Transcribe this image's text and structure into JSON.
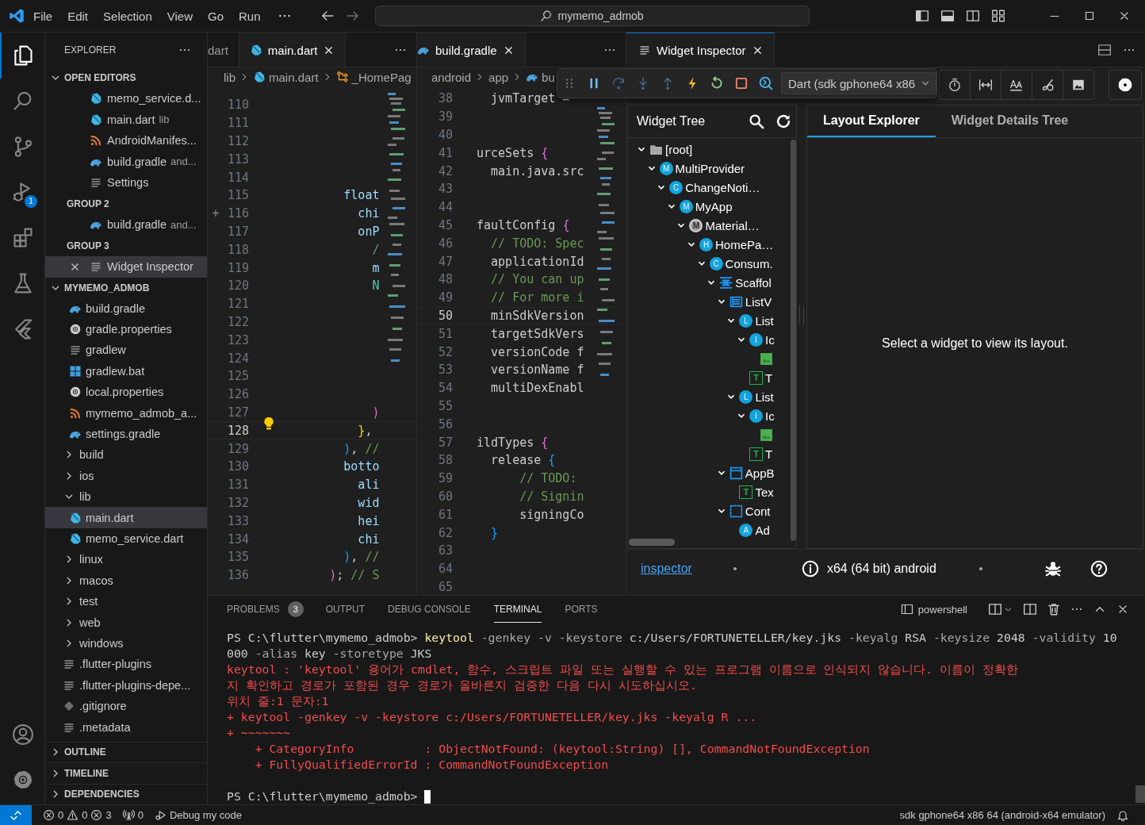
{
  "title_bar": {
    "menus": [
      "File",
      "Edit",
      "Selection",
      "View",
      "Go",
      "Run"
    ],
    "search": "mymemo_admob"
  },
  "activity_bar": {
    "items": [
      {
        "kind": "explorer",
        "selected": true
      },
      {
        "kind": "search",
        "selected": false
      },
      {
        "kind": "source-control",
        "selected": false
      },
      {
        "kind": "run-debug",
        "selected": false,
        "badge": "1"
      },
      {
        "kind": "extensions",
        "selected": false
      },
      {
        "kind": "testing",
        "selected": false
      },
      {
        "kind": "flutter",
        "selected": false
      }
    ],
    "bottom": [
      {
        "kind": "account"
      },
      {
        "kind": "manage"
      }
    ]
  },
  "sidebar": {
    "title": "EXPLORER",
    "open_editors": {
      "title": "OPEN EDITORS",
      "expanded": true,
      "groups": [
        {
          "items": [
            {
              "label": "memo_service.d...",
              "kind": "dart",
              "selected": false
            },
            {
              "label": "main.dart",
              "kind": "dart",
              "description": "lib",
              "selected": false
            },
            {
              "label": "AndroidManifes...",
              "kind": "xml",
              "selected": false
            },
            {
              "label": "build.gradle",
              "kind": "gradle",
              "description": "and...",
              "selected": false
            },
            {
              "label": "Settings",
              "kind": "lines",
              "selected": false
            }
          ]
        },
        {
          "title": "GROUP 2",
          "items": [
            {
              "label": "build.gradle",
              "kind": "gradle",
              "description": "and...",
              "selected": false
            }
          ]
        },
        {
          "title": "GROUP 3",
          "items": [
            {
              "label": "Widget Inspector",
              "kind": "lines",
              "selected": true
            }
          ]
        }
      ]
    },
    "project": {
      "title": "MYMEMO_ADMOB",
      "expanded": true,
      "items": [
        {
          "children": [
            {
              "label": "build.gradle",
              "kind": "gradle",
              "selected": false
            },
            {
              "label": "gradle.properties",
              "kind": "gear",
              "selected": false
            },
            {
              "label": "gradlew",
              "kind": "lines",
              "selected": false
            },
            {
              "label": "gradlew.bat",
              "kind": "windows",
              "selected": false
            },
            {
              "label": "local.properties",
              "kind": "gear",
              "selected": false
            },
            {
              "label": "mymemo_admob_a...",
              "kind": "xml",
              "selected": false
            },
            {
              "label": "settings.gradle",
              "kind": "gradle",
              "selected": false
            }
          ]
        },
        {
          "label": "build",
          "kind": "folder",
          "expanded": false
        },
        {
          "label": "ios",
          "kind": "folder",
          "expanded": false
        },
        {
          "label": "lib",
          "kind": "folder",
          "expanded": true,
          "children": [
            {
              "label": "main.dart",
              "kind": "dart",
              "selected": true
            },
            {
              "label": "memo_service.dart",
              "kind": "dart",
              "selected": false
            }
          ]
        },
        {
          "label": "linux",
          "kind": "folder",
          "expanded": false
        },
        {
          "label": "macos",
          "kind": "folder",
          "expanded": false
        },
        {
          "label": "test",
          "kind": "folder",
          "expanded": false
        },
        {
          "label": "web",
          "kind": "folder",
          "expanded": false
        },
        {
          "label": "windows",
          "kind": "folder",
          "expanded": false
        },
        {
          "label": ".flutter-plugins",
          "kind": "lines",
          "selected": false
        },
        {
          "label": ".flutter-plugins-depe...",
          "kind": "lines",
          "selected": false
        },
        {
          "label": ".gitignore",
          "kind": "git",
          "selected": false
        },
        {
          "label": ".metadata",
          "kind": "lines",
          "selected": false
        }
      ]
    },
    "sections": [
      {
        "title": "OUTLINE",
        "expanded": false
      },
      {
        "title": "TIMELINE",
        "expanded": false
      },
      {
        "title": "DEPENDENCIES",
        "expanded": false
      }
    ]
  },
  "editor_groups": [
    {
      "active": false,
      "tabs": [
        {
          "label": "dart",
          "kind": "plain",
          "selected": false
        },
        {
          "label": "main.dart",
          "kind": "dart",
          "selected": true
        }
      ],
      "breadcrumbs": [
        {
          "label": "lib",
          "kind": "plain"
        },
        {
          "label": "main.dart",
          "kind": "dart"
        },
        {
          "label": "_HomePag",
          "kind": "class"
        }
      ],
      "lines": [
        {
          "number": "110",
          "current": false
        },
        {
          "number": "111",
          "current": false
        },
        {
          "number": "112",
          "current": false
        },
        {
          "number": "113",
          "current": false
        },
        {
          "number": "114",
          "current": false
        },
        {
          "number": "115",
          "current": false,
          "parts": [
            {
              "text": "          float",
              "kind": "property"
            }
          ]
        },
        {
          "number": "116",
          "current": false,
          "gutter": "+",
          "parts": [
            {
              "text": "            chi",
              "kind": "property"
            }
          ]
        },
        {
          "number": "117",
          "current": false,
          "parts": [
            {
              "text": "            onP",
              "kind": "property"
            }
          ]
        },
        {
          "number": "118",
          "current": false,
          "parts": [
            {
              "text": "              /",
              "kind": "comment"
            }
          ]
        },
        {
          "number": "119",
          "current": false,
          "parts": [
            {
              "text": "              m",
              "kind": "property"
            }
          ]
        },
        {
          "number": "120",
          "current": false,
          "parts": [
            {
              "text": "              N",
              "kind": "type"
            }
          ]
        },
        {
          "number": "121",
          "current": false
        },
        {
          "number": "122",
          "current": false
        },
        {
          "number": "123",
          "current": false
        },
        {
          "number": "124",
          "current": false
        },
        {
          "number": "125",
          "current": false
        },
        {
          "number": "126",
          "current": false
        },
        {
          "number": "127",
          "current": false,
          "parts": [
            {
              "text": "              )",
              "kind": "bracket-pink"
            }
          ]
        },
        {
          "number": "128",
          "current": true,
          "lightbulb": true,
          "parts": [
            {
              "text": "            }",
              "kind": "bracket-yellow"
            },
            {
              "text": ",",
              "kind": "plain"
            }
          ]
        },
        {
          "number": "129",
          "current": false,
          "parts": [
            {
              "text": "          )",
              "kind": "bracket-blue"
            },
            {
              "text": ", ",
              "kind": "plain"
            },
            {
              "text": "//",
              "kind": "comment"
            }
          ]
        },
        {
          "number": "130",
          "current": false,
          "parts": [
            {
              "text": "          botto",
              "kind": "property"
            }
          ]
        },
        {
          "number": "131",
          "current": false,
          "parts": [
            {
              "text": "            ali",
              "kind": "property"
            }
          ]
        },
        {
          "number": "132",
          "current": false,
          "parts": [
            {
              "text": "            wid",
              "kind": "property"
            }
          ]
        },
        {
          "number": "133",
          "current": false,
          "parts": [
            {
              "text": "            hei",
              "kind": "property"
            }
          ]
        },
        {
          "number": "134",
          "current": false,
          "parts": [
            {
              "text": "            chi",
              "kind": "property"
            }
          ]
        },
        {
          "number": "135",
          "current": false,
          "parts": [
            {
              "text": "          )",
              "kind": "bracket-blue"
            },
            {
              "text": ", ",
              "kind": "plain"
            },
            {
              "text": "//",
              "kind": "comment"
            }
          ]
        },
        {
          "number": "136",
          "current": false,
          "parts": [
            {
              "text": "        )",
              "kind": "bracket-pink"
            },
            {
              "text": "; ",
              "kind": "plain"
            },
            {
              "text": "// S",
              "kind": "comment"
            }
          ]
        }
      ]
    },
    {
      "active": false,
      "tabs": [
        {
          "label": "build.gradle",
          "kind": "gradle",
          "selected": true
        }
      ],
      "breadcrumbs": [
        {
          "label": "android",
          "kind": "plain"
        },
        {
          "label": "app",
          "kind": "plain"
        },
        {
          "label": "bu",
          "kind": "gradle"
        }
      ],
      "lines": [
        {
          "number": "38",
          "current": false,
          "parts": [
            {
              "text": "  jvmTarget =",
              "kind": "plain"
            }
          ]
        },
        {
          "number": "39",
          "current": false
        },
        {
          "number": "40",
          "current": false
        },
        {
          "number": "41",
          "current": false,
          "parts": [
            {
              "text": "urceSets ",
              "kind": "plain"
            },
            {
              "text": "{",
              "kind": "bracket-pink"
            }
          ]
        },
        {
          "number": "42",
          "current": false,
          "parts": [
            {
              "text": "  main.java.src",
              "kind": "plain"
            }
          ]
        },
        {
          "number": "43",
          "current": false
        },
        {
          "number": "44",
          "current": false
        },
        {
          "number": "45",
          "current": false,
          "parts": [
            {
              "text": "faultConfig ",
              "kind": "plain"
            },
            {
              "text": "{",
              "kind": "bracket-pink"
            }
          ]
        },
        {
          "number": "46",
          "current": false,
          "parts": [
            {
              "text": "  // TODO: Spec",
              "kind": "comment"
            }
          ]
        },
        {
          "number": "47",
          "current": false,
          "parts": [
            {
              "text": "  applicationId",
              "kind": "plain"
            }
          ]
        },
        {
          "number": "48",
          "current": false,
          "parts": [
            {
              "text": "  // You can up",
              "kind": "comment"
            }
          ]
        },
        {
          "number": "49",
          "current": false,
          "parts": [
            {
              "text": "  // For more i",
              "kind": "comment"
            }
          ]
        },
        {
          "number": "50",
          "current": true,
          "parts": [
            {
              "text": "  minSdkVersion",
              "kind": "plain"
            }
          ]
        },
        {
          "number": "51",
          "current": false,
          "parts": [
            {
              "text": "  targetSdkVers",
              "kind": "plain"
            }
          ]
        },
        {
          "number": "52",
          "current": false,
          "parts": [
            {
              "text": "  versionCode f",
              "kind": "plain"
            }
          ]
        },
        {
          "number": "53",
          "current": false,
          "parts": [
            {
              "text": "  versionName f",
              "kind": "plain"
            }
          ]
        },
        {
          "number": "54",
          "current": false,
          "parts": [
            {
              "text": "  multiDexEnabl",
              "kind": "plain"
            }
          ]
        },
        {
          "number": "55",
          "current": false
        },
        {
          "number": "56",
          "current": false
        },
        {
          "number": "57",
          "current": false,
          "parts": [
            {
              "text": "ildTypes ",
              "kind": "plain"
            },
            {
              "text": "{",
              "kind": "bracket-pink"
            }
          ]
        },
        {
          "number": "58",
          "current": false,
          "parts": [
            {
              "text": "  release ",
              "kind": "plain"
            },
            {
              "text": "{",
              "kind": "bracket-blue"
            }
          ]
        },
        {
          "number": "59",
          "current": false,
          "parts": [
            {
              "text": "      // TODO:",
              "kind": "comment"
            }
          ]
        },
        {
          "number": "60",
          "current": false,
          "parts": [
            {
              "text": "      // Signin",
              "kind": "comment"
            }
          ]
        },
        {
          "number": "61",
          "current": false,
          "parts": [
            {
              "text": "      signingCo",
              "kind": "plain"
            }
          ]
        },
        {
          "number": "62",
          "current": false,
          "parts": [
            {
              "text": "  }",
              "kind": "bracket-blue"
            }
          ]
        },
        {
          "number": "63",
          "current": false
        },
        {
          "number": "64",
          "current": false
        },
        {
          "number": "65",
          "current": false
        }
      ]
    },
    {
      "active": true,
      "tabs": [
        {
          "label": "Widget Inspector",
          "kind": "lines",
          "selected": true
        }
      ]
    }
  ],
  "debug_toolbar": {
    "target": "Dart (sdk gphone64 x86"
  },
  "widget_inspector": {
    "widget_tree": {
      "title": "Widget Tree",
      "nodes": [
        {
          "label": "[root]",
          "kind": "folder",
          "expanded": true,
          "children": [
            {
              "label": "MultiProvider",
              "kind": "circle",
              "badge": "M",
              "expanded": true,
              "children": [
                {
                  "label": "ChangeNoti…",
                  "kind": "circle",
                  "badge": "C",
                  "expanded": true,
                  "children": [
                    {
                      "label": "MyApp",
                      "kind": "circle",
                      "badge": "M",
                      "expanded": true,
                      "children": [
                        {
                          "label": "Material…",
                          "kind": "material",
                          "badge": "M",
                          "expanded": true,
                          "children": [
                            {
                              "label": "HomePa…",
                              "kind": "circle",
                              "badge": "H",
                              "expanded": true,
                              "children": [
                                {
                                  "label": "Consum.",
                                  "kind": "circle",
                                  "badge": "C",
                                  "expanded": true,
                                  "children": [
                                    {
                                      "label": "Scaffol",
                                      "kind": "scaffold",
                                      "expanded": true,
                                      "children": [
                                        {
                                          "label": "ListV",
                                          "kind": "list-view",
                                          "expanded": true,
                                          "children": [
                                            {
                                              "label": "List",
                                              "kind": "circle",
                                              "badge": "L",
                                              "expanded": true,
                                              "children": [
                                                {
                                                  "label": "Ic",
                                                  "kind": "circle",
                                                  "badge": "I",
                                                  "expanded": true,
                                                  "children": [
                                                    {
                                                      "kind": "image"
                                                    }
                                                  ]
                                                },
                                                {
                                                  "label": "T",
                                                  "kind": "text",
                                                  "badge": "T"
                                                }
                                              ]
                                            },
                                            {
                                              "label": "List",
                                              "kind": "circle",
                                              "badge": "L",
                                              "expanded": true,
                                              "children": [
                                                {
                                                  "label": "Ic",
                                                  "kind": "circle",
                                                  "badge": "I",
                                                  "expanded": true,
                                                  "children": [
                                                    {
                                                      "kind": "image"
                                                    }
                                                  ]
                                                },
                                                {
                                                  "label": "T",
                                                  "kind": "text",
                                                  "badge": "T"
                                                }
                                              ]
                                            }
                                          ]
                                        },
                                        {
                                          "label": "AppB",
                                          "kind": "app-bar",
                                          "expanded": true,
                                          "children": [
                                            {
                                              "label": "Tex",
                                              "kind": "text",
                                              "badge": "T"
                                            }
                                          ]
                                        },
                                        {
                                          "label": "Cont",
                                          "kind": "container",
                                          "expanded": true,
                                          "children": [
                                            {
                                              "label": "Ad",
                                              "kind": "circle",
                                              "badge": "A"
                                            }
                                          ]
                                        }
                                      ]
                                    }
                                  ]
                                }
                              ]
                            }
                          ]
                        }
                      ]
                    }
                  ]
                }
              ]
            }
          ]
        }
      ]
    },
    "details": {
      "tabs": [
        {
          "label": "Layout Explorer",
          "selected": true
        },
        {
          "label": "Widget Details Tree",
          "selected": false
        }
      ],
      "message": "Select a widget to view its layout."
    },
    "footer": {
      "link": "inspector",
      "platform": "x64 (64 bit) android"
    }
  },
  "panel": {
    "tabs": [
      {
        "label": "PROBLEMS",
        "badge": "3",
        "selected": false
      },
      {
        "label": "OUTPUT",
        "selected": false
      },
      {
        "label": "DEBUG CONSOLE",
        "selected": false
      },
      {
        "label": "TERMINAL",
        "selected": true
      },
      {
        "label": "PORTS",
        "selected": false
      }
    ],
    "terminal_name": "powershell",
    "lines": [
      {
        "parts": [
          {
            "text": "PS C:\\flutter\\mymemo_admob> ",
            "kind": "plain"
          },
          {
            "text": "keytool",
            "kind": "command"
          },
          {
            "text": " -genkey -v -keystore ",
            "kind": "param"
          },
          {
            "text": "c:/Users/FORTUNETELLER/key.jks",
            "kind": "plain"
          },
          {
            "text": " -keyalg ",
            "kind": "param"
          },
          {
            "text": "RSA",
            "kind": "plain"
          },
          {
            "text": " -keysize ",
            "kind": "param"
          },
          {
            "text": "2048",
            "kind": "plain"
          },
          {
            "text": " -validity ",
            "kind": "param"
          },
          {
            "text": "10",
            "kind": "plain"
          }
        ]
      },
      {
        "parts": [
          {
            "text": "000",
            "kind": "plain"
          },
          {
            "text": " -alias ",
            "kind": "param"
          },
          {
            "text": "key",
            "kind": "plain"
          },
          {
            "text": " -storetype ",
            "kind": "param"
          },
          {
            "text": "JKS",
            "kind": "plain"
          }
        ]
      },
      {
        "parts": [
          {
            "text": "keytool : 'keytool' 용어가 cmdlet, 함수, 스크립트 파일 또는 실행할 수 있는 프로그램 이름으로 인식되지 않습니다. 이름이 정확한",
            "kind": "error"
          }
        ]
      },
      {
        "parts": [
          {
            "text": "지 확인하고 경로가 포함된 경우 경로가 올바른지 검증한 다음 다시 시도하십시오.",
            "kind": "error"
          }
        ]
      },
      {
        "parts": [
          {
            "text": "위치 줄:1 문자:1",
            "kind": "error"
          }
        ]
      },
      {
        "parts": [
          {
            "text": "+ keytool -genkey -v -keystore c:/Users/FORTUNETELLER/key.jks -keyalg R ...",
            "kind": "error"
          }
        ]
      },
      {
        "parts": [
          {
            "text": "+ ~~~~~~~",
            "kind": "error"
          }
        ]
      },
      {
        "parts": [
          {
            "text": "    + CategoryInfo          : ObjectNotFound: (keytool:String) [], CommandNotFoundException",
            "kind": "error"
          }
        ]
      },
      {
        "parts": [
          {
            "text": "    + FullyQualifiedErrorId : CommandNotFoundException",
            "kind": "error"
          }
        ]
      },
      {
        "kind": "blank"
      },
      {
        "parts": [
          {
            "text": "PS C:\\flutter\\mymemo_admob> ",
            "kind": "plain"
          }
        ],
        "cursor": true
      }
    ]
  },
  "status_bar": {
    "errors": "0",
    "warnings": "0",
    "infos": "3",
    "ports": "0",
    "debug": "Debug my code",
    "device": "sdk gphone64 x86 64 (android-x64 emulator)"
  }
}
